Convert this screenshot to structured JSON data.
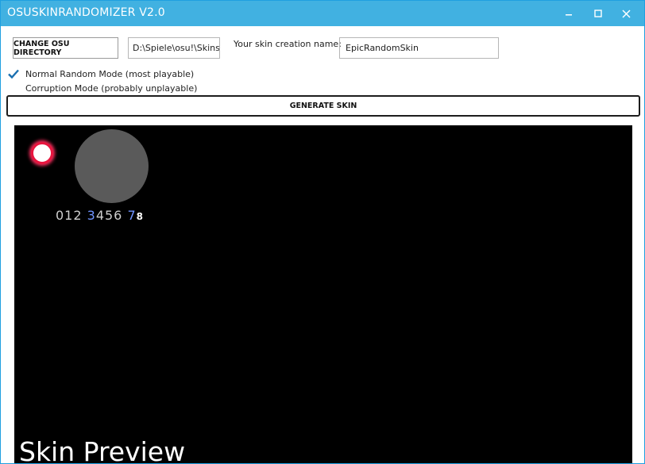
{
  "window": {
    "title": "OSUSKINRANDOMIZER V2.0",
    "controls": {
      "minimize": "‒",
      "maximize": "□",
      "close": "✕"
    }
  },
  "toolbar": {
    "change_dir_label": "CHANGE OSU DIRECTORY",
    "directory_value": "D:\\Spiele\\osu!\\Skins",
    "name_label": "Your skin creation name:",
    "name_value": "EpicRandomSkin"
  },
  "options": [
    {
      "label": "Normal Random Mode (most playable)",
      "checked": true
    },
    {
      "label": "Corruption Mode (probably unplayable)",
      "checked": false
    }
  ],
  "generate_label": "GENERATE SKIN",
  "preview": {
    "label": "Skin Preview",
    "digits_part1": "012 ",
    "digits_part2": "3",
    "digits_part3": "456 ",
    "digits_part4": "7",
    "digits_part5": "8"
  },
  "colors": {
    "titlebar": "#41b1e1",
    "check_accent": "#1a6fb0",
    "hit_circle_border": "#e8153e",
    "preview_bg": "#000000"
  }
}
